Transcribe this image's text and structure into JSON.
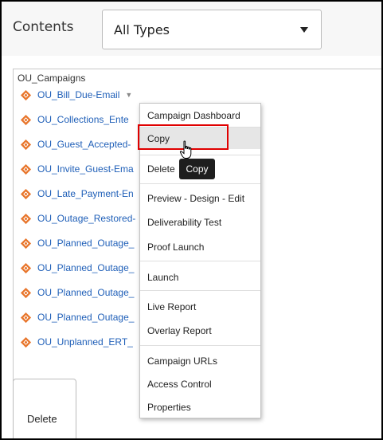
{
  "header": {
    "contents_label": "Contents",
    "type_select": {
      "selected": "All Types"
    }
  },
  "tree": {
    "root": "OU_Campaigns",
    "items": [
      {
        "label": "OU_Bill_Due-Email"
      },
      {
        "label": "OU_Collections_Ente"
      },
      {
        "label": "OU_Guest_Accepted-"
      },
      {
        "label": "OU_Invite_Guest-Ema"
      },
      {
        "label": "OU_Late_Payment-En"
      },
      {
        "label": "OU_Outage_Restored-"
      },
      {
        "label": "OU_Planned_Outage_"
      },
      {
        "label": "OU_Planned_Outage_"
      },
      {
        "label": "OU_Planned_Outage_"
      },
      {
        "label": "OU_Planned_Outage_"
      },
      {
        "label": "OU_Unplanned_ERT_"
      }
    ]
  },
  "context_menu": {
    "items": [
      {
        "label": "Campaign Dashboard"
      },
      {
        "label": "Copy"
      },
      {
        "label": "Delete"
      },
      {
        "label": "Preview - Design - Edit"
      },
      {
        "label": "Deliverability Test"
      },
      {
        "label": "Proof Launch"
      },
      {
        "label": "Launch"
      },
      {
        "label": "Live Report"
      },
      {
        "label": "Overlay Report"
      },
      {
        "label": "Campaign URLs"
      },
      {
        "label": "Access Control"
      },
      {
        "label": "Properties"
      }
    ]
  },
  "tooltip": {
    "text": "Copy"
  },
  "bottom": {
    "delete_label": "Delete"
  },
  "icons": {
    "campaign": "campaign-icon",
    "dropdown": "chevron-down-icon",
    "cursor": "hand-pointer-icon"
  },
  "colors": {
    "accent_link": "#1f5fb8",
    "highlight_border": "#e00000",
    "icon_orange": "#e8762c"
  }
}
